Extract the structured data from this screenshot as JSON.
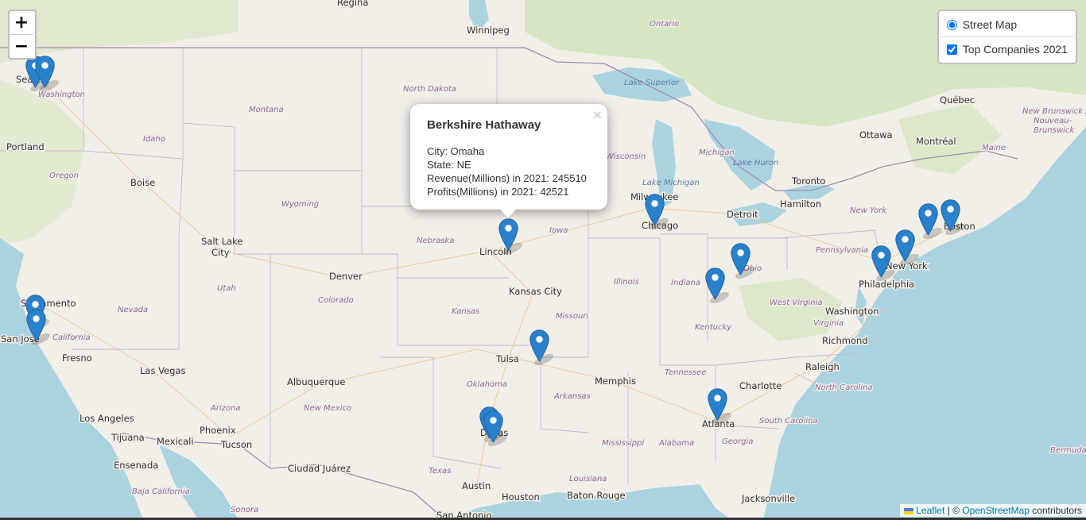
{
  "map": {
    "zoom_in_label": "+",
    "zoom_out_label": "−",
    "colors": {
      "land": "#f2efe9",
      "water": "#aad3df",
      "forest": "#cfe3b8",
      "marker": "#2a81cb"
    }
  },
  "layers": {
    "base": {
      "label": "Street Map",
      "selected": true
    },
    "overlay": {
      "label": "Top Companies 2021",
      "checked": true
    }
  },
  "popup": {
    "title": "Berkshire Hathaway",
    "city_line": "City: Omaha",
    "state_line": "State: NE",
    "revenue_line": "Revenue(Millions) in 2021: 245510",
    "profits_line": "Profits(Millions) in 2021: 42521",
    "close_label": "×"
  },
  "attribution": {
    "leaflet": "Leaflet",
    "separator": " | © ",
    "osm": "OpenStreetMap",
    "suffix": " contributors"
  },
  "labels": {
    "cities": [
      "Regina",
      "Winnipeg",
      "Seattle",
      "Portland",
      "Boise",
      "Salt Lake City",
      "Denver",
      "Lincoln",
      "Kansas City",
      "Chicago",
      "Milwaukee",
      "Detroit",
      "Toronto",
      "Hamilton",
      "Ottawa",
      "Montréal",
      "Québec",
      "Boston",
      "New York",
      "Philadelphia",
      "Washington",
      "Richmond",
      "Raleigh",
      "Charlotte",
      "Atlanta",
      "Jacksonville",
      "Memphis",
      "Tulsa",
      "Dallas",
      "Austin",
      "Houston",
      "Baton Rouge",
      "San Antonio",
      "Sacramento",
      "San Jose",
      "Fresno",
      "Las Vegas",
      "Los Angeles",
      "Tijuana",
      "Mexicali",
      "Ensenada",
      "Phoenix",
      "Tucson",
      "Albuquerque",
      "Ciudad Juárez"
    ],
    "regions": [
      "Ontario",
      "North Dakota",
      "Montana",
      "Washington",
      "Idaho",
      "Oregon",
      "Wyoming",
      "Nebraska",
      "Iowa",
      "Wisconsin",
      "Michigan",
      "Utah",
      "Colorado",
      "Kansas",
      "Missouri",
      "Illinois",
      "Indiana",
      "Ohio",
      "Kentucky",
      "West Virginia",
      "Virginia",
      "Pennsylvania",
      "New York",
      "New Brunswick / Nouveau-Brunswick",
      "Maine",
      "Tennessee",
      "North Carolina",
      "South Carolina",
      "Georgia",
      "Alabama",
      "Mississippi",
      "Arkansas",
      "Oklahoma",
      "Texas",
      "Louisiana",
      "New Mexico",
      "Arizona",
      "Nevada",
      "California",
      "Baja California",
      "Sonora",
      "Bermuda"
    ],
    "water": [
      "Lake Superior",
      "Lake Michigan",
      "Lake Huron"
    ]
  },
  "markers": [
    {
      "name": "marker-seattle-1"
    },
    {
      "name": "marker-seattle-2"
    },
    {
      "name": "marker-sacramento"
    },
    {
      "name": "marker-san-jose"
    },
    {
      "name": "marker-omaha"
    },
    {
      "name": "marker-milwaukee"
    },
    {
      "name": "marker-dallas-1"
    },
    {
      "name": "marker-dallas-2"
    },
    {
      "name": "marker-bentonville"
    },
    {
      "name": "marker-indiana"
    },
    {
      "name": "marker-ohio"
    },
    {
      "name": "marker-atlanta"
    },
    {
      "name": "marker-philadelphia"
    },
    {
      "name": "marker-new-york"
    },
    {
      "name": "marker-connecticut"
    },
    {
      "name": "marker-boston"
    }
  ]
}
